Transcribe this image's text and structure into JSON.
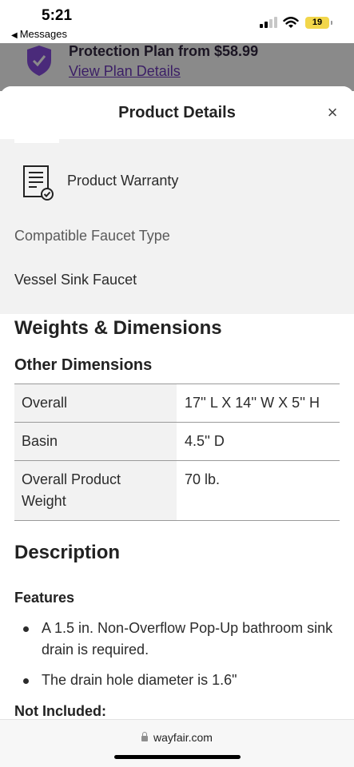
{
  "status_bar": {
    "time": "5:21",
    "back_app": "Messages",
    "battery": "19"
  },
  "background_page": {
    "protection_title": "Protection Plan from $58.99",
    "protection_link": "View Plan Details",
    "accent_color": "#3b1e66"
  },
  "sheet": {
    "title": "Product Details",
    "close_symbol": "×"
  },
  "warranty": {
    "label": "Product Warranty",
    "icon": "document-check-icon"
  },
  "spec": {
    "label": "Compatible Faucet Type",
    "value": "Vessel Sink Faucet"
  },
  "weights_heading": "Weights & Dimensions",
  "other_dimensions_heading": "Other Dimensions",
  "dimensions": [
    {
      "name": "Overall",
      "value": "17'' L X 14'' W X 5'' H"
    },
    {
      "name": "Basin",
      "value": "4.5'' D"
    },
    {
      "name": "Overall Product Weight",
      "value": "70 lb."
    }
  ],
  "description_heading": "Description",
  "features_heading": "Features",
  "features": [
    "A 1.5 in. Non-Overflow Pop-Up bathroom sink drain is required.",
    "The drain hole diameter is 1.6\""
  ],
  "not_included_heading": "Not Included:",
  "browser": {
    "url": "wayfair.com"
  }
}
